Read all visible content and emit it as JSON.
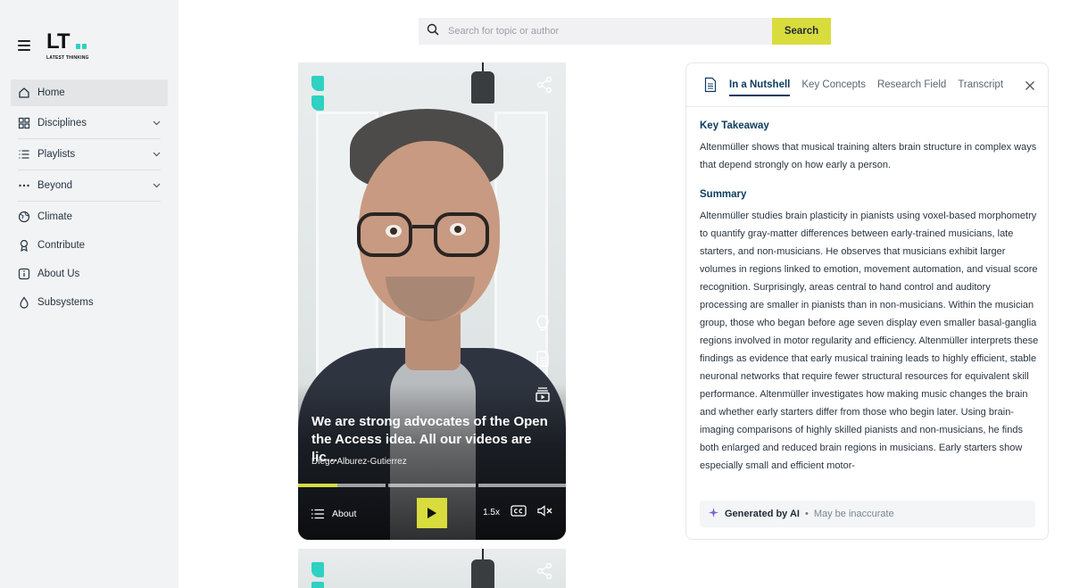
{
  "brand": {
    "logo_text": "LT",
    "logo_subtitle": "LATEST THINKING"
  },
  "sidebar": {
    "items": [
      {
        "label": "Home",
        "icon": "home-icon",
        "active": true,
        "has_chevron": false
      },
      {
        "label": "Disciplines",
        "icon": "grid-icon",
        "active": false,
        "has_chevron": true
      },
      {
        "label": "Playlists",
        "icon": "list-icon",
        "active": false,
        "has_chevron": true
      },
      {
        "label": "Beyond",
        "icon": "dots-icon",
        "active": false,
        "has_chevron": true
      },
      {
        "label": "Climate",
        "icon": "globe-icon",
        "active": false,
        "has_chevron": false
      },
      {
        "label": "Contribute",
        "icon": "ribbon-icon",
        "active": false,
        "has_chevron": false
      },
      {
        "label": "About Us",
        "icon": "info-icon",
        "active": false,
        "has_chevron": false
      },
      {
        "label": "Subsystems",
        "icon": "drop-icon",
        "active": false,
        "has_chevron": false
      }
    ]
  },
  "search": {
    "placeholder": "Search for topic or author",
    "button_label": "Search"
  },
  "video": {
    "caption": "We are strong advocates of the Open the Access idea. All our videos are lic...",
    "author": "Diego Alburez-Gutierrez",
    "progress_segments": [
      0.45,
      0,
      0
    ],
    "controls": {
      "about_label": "About",
      "speed": "1.5x"
    }
  },
  "panel": {
    "tabs": [
      "In a Nutshell",
      "Key Concepts",
      "Research Field",
      "Transcript"
    ],
    "active_tab": "In a Nutshell",
    "key_takeaway_title": "Key Takeaway",
    "key_takeaway_text": "Altenmüller shows that musical training alters brain structure in complex ways that depend strongly on how early a person.",
    "summary_title": "Summary",
    "summary_text": "Altenmüller studies brain plasticity in pianists using voxel-based morphometry to quantify gray-matter differences between early-trained musicians, late starters, and non-musicians. He observes that musicians exhibit larger volumes in regions linked to emotion, movement automation, and visual score recognition. Surprisingly, areas central to hand control and auditory processing are smaller in pianists than in non-musicians. Within the musician group, those who began before age seven display even smaller basal-ganglia regions involved in motor regularity and efficiency. Altenmüller interprets these findings as evidence that early musical training leads to highly efficient, stable neuronal networks that require fewer structural resources for equivalent skill performance. Altenmüller investigates how making music changes the brain and whether early starters differ from those who begin later. Using brain-imaging comparisons of highly skilled pianists and non-musicians, he finds both enlarged and reduced brain regions in musicians. Early starters show especially small and efficient motor-",
    "ai_label": "Generated by AI",
    "ai_note": "May be inaccurate"
  },
  "colors": {
    "accent_yellow": "#d8dc3c",
    "brand_teal": "#2ed1c2",
    "navy": "#0e3b5e",
    "sidebar_bg": "#f2f3f4"
  }
}
